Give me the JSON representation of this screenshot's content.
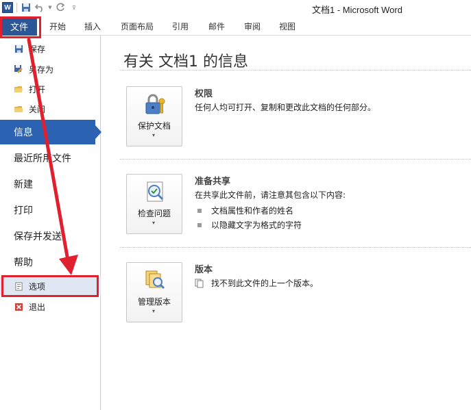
{
  "window": {
    "title": "文档1  -  Microsoft Word",
    "logo_letter": "W"
  },
  "ribbon": {
    "file_tab": "文件",
    "tabs": [
      "开始",
      "插入",
      "页面布局",
      "引用",
      "邮件",
      "审阅",
      "视图"
    ]
  },
  "nav": {
    "save": "保存",
    "save_as": "另存为",
    "open": "打开",
    "close": "关闭",
    "info": "信息",
    "recent": "最近所用文件",
    "new": "新建",
    "print": "打印",
    "save_send": "保存并发送",
    "help": "帮助",
    "options": "选项",
    "exit": "退出"
  },
  "main": {
    "heading": "有关 文档1 的信息",
    "permissions": {
      "button": "保护文档",
      "title": "权限",
      "desc": "任何人均可打开、复制和更改此文档的任何部分。"
    },
    "prepare": {
      "button": "检查问题",
      "title": "准备共享",
      "desc": "在共享此文件前，请注意其包含以下内容:",
      "bullets": [
        "文档属性和作者的姓名",
        "以隐藏文字为格式的字符"
      ]
    },
    "versions": {
      "button": "管理版本",
      "title": "版本",
      "desc": "找不到此文件的上一个版本。"
    }
  },
  "colors": {
    "accent": "#2b63b2",
    "annotation": "#e0202e"
  }
}
